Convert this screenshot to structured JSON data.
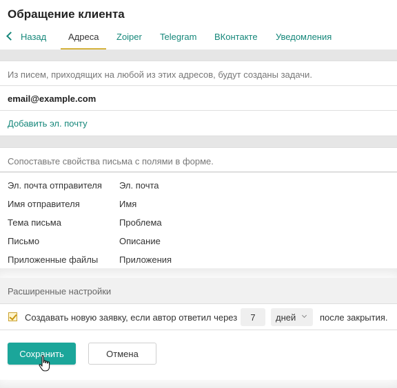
{
  "header": {
    "title": "Обращение клиента",
    "tabs": [
      {
        "label": "Назад",
        "icon": "chevron-left-icon"
      },
      {
        "label": "Адреса",
        "active": true
      },
      {
        "label": "Zoiper"
      },
      {
        "label": "Telegram"
      },
      {
        "label": "ВКонтакте"
      },
      {
        "label": "Уведомления"
      }
    ]
  },
  "addresses": {
    "info": "Из писем, приходящих на любой из этих адресов, будут созданы задачи.",
    "email": "email@example.com",
    "add_link": "Добавить эл. почту"
  },
  "mapping": {
    "info": "Сопоставьте свойства письма с полями в форме.",
    "rows": [
      {
        "property": "Эл. почта отправителя",
        "field": "Эл. почта"
      },
      {
        "property": "Имя отправителя",
        "field": "Имя"
      },
      {
        "property": "Тема письма",
        "field": "Проблема"
      },
      {
        "property": "Письмо",
        "field": "Описание"
      },
      {
        "property": "Приложенные файлы",
        "field": "Приложения"
      }
    ]
  },
  "advanced": {
    "title": "Расширенные настройки",
    "reopen_checked": true,
    "reopen_text": "Создавать новую заявку, если автор ответил через",
    "days_value": "7",
    "unit_selected": "дней",
    "after_text": "после закрытия."
  },
  "actions": {
    "save": "Сохранить",
    "cancel": "Отмена"
  },
  "colors": {
    "accent": "#1ba69a",
    "link": "#15877a",
    "active_tab_underline": "#d4b13a"
  }
}
